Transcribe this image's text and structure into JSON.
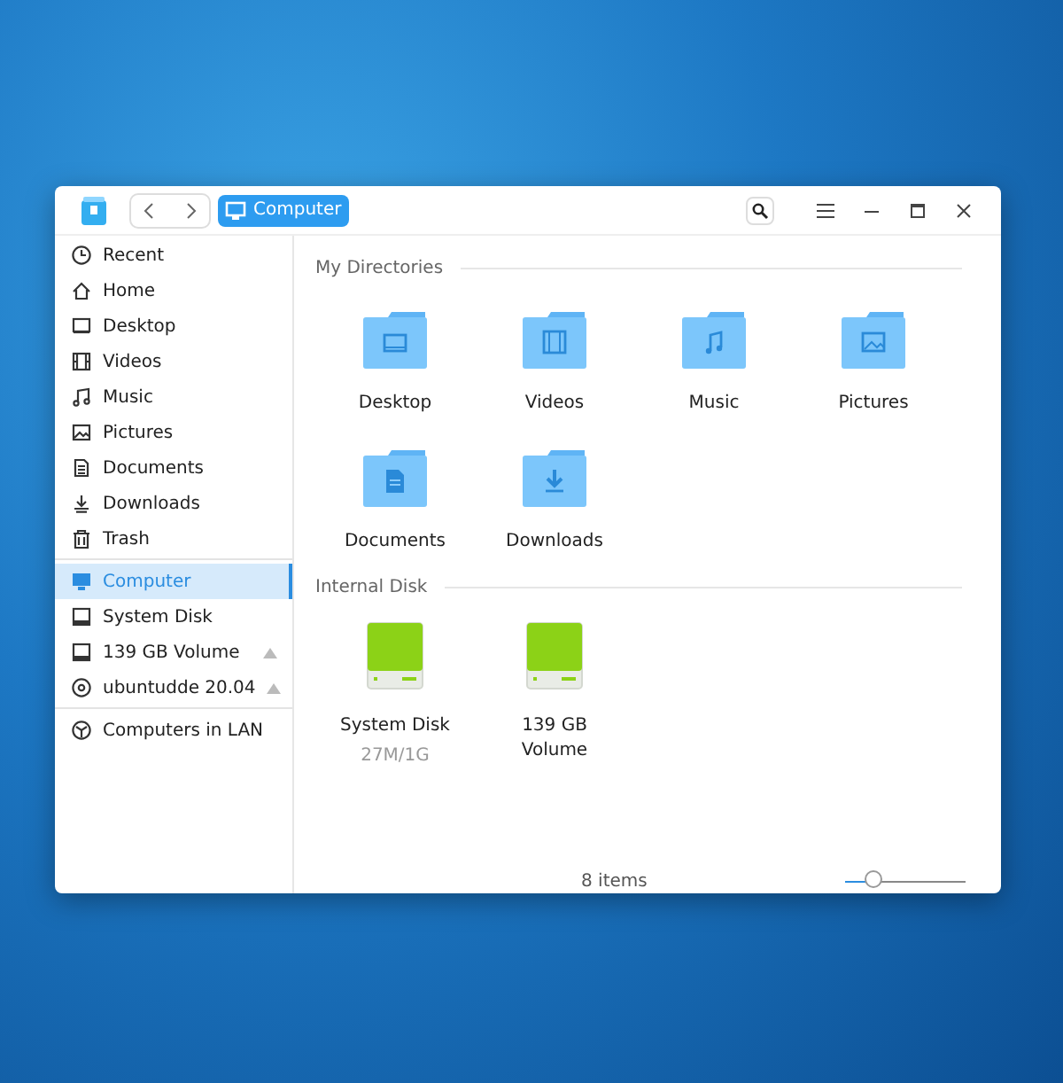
{
  "titlebar": {
    "location": "Computer"
  },
  "sidebar": {
    "groups": [
      [
        {
          "label": "Recent",
          "kind": "recent",
          "selected": false
        },
        {
          "label": "Home",
          "kind": "home",
          "selected": false
        },
        {
          "label": "Desktop",
          "kind": "desktop",
          "selected": false
        },
        {
          "label": "Videos",
          "kind": "videos",
          "selected": false
        },
        {
          "label": "Music",
          "kind": "music",
          "selected": false
        },
        {
          "label": "Pictures",
          "kind": "pictures",
          "selected": false
        },
        {
          "label": "Documents",
          "kind": "documents",
          "selected": false
        },
        {
          "label": "Downloads",
          "kind": "downloads",
          "selected": false
        },
        {
          "label": "Trash",
          "kind": "trash",
          "selected": false
        }
      ],
      [
        {
          "label": "Computer",
          "kind": "computer",
          "selected": true
        },
        {
          "label": "System Disk",
          "kind": "disk",
          "selected": false
        },
        {
          "label": "139 GB Volume",
          "kind": "disk",
          "selected": false,
          "ejectable": true
        },
        {
          "label": "ubuntudde 20.04",
          "kind": "optical",
          "selected": false,
          "ejectable": true
        }
      ],
      [
        {
          "label": "Computers in LAN",
          "kind": "network",
          "selected": false
        }
      ]
    ]
  },
  "sections": [
    {
      "title": "My Directories",
      "kind": "folders",
      "items": [
        {
          "label": "Desktop",
          "kind": "desktop"
        },
        {
          "label": "Videos",
          "kind": "videos"
        },
        {
          "label": "Music",
          "kind": "music"
        },
        {
          "label": "Pictures",
          "kind": "pictures"
        },
        {
          "label": "Documents",
          "kind": "documents"
        },
        {
          "label": "Downloads",
          "kind": "downloads"
        }
      ]
    },
    {
      "title": "Internal Disk",
      "kind": "disks",
      "items": [
        {
          "label": "System Disk",
          "usage": "27M/1G"
        },
        {
          "label": "139 GB Volume"
        }
      ]
    }
  ],
  "status_bar": {
    "count": "8 items",
    "zoom": {
      "level": 0.25
    }
  }
}
